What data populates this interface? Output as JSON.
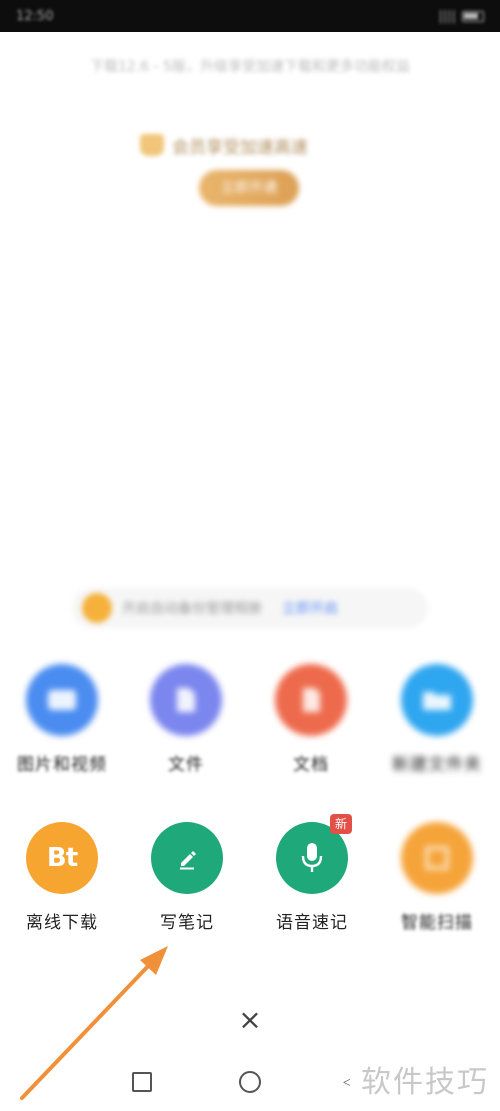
{
  "status_bar": {
    "time": "12:50",
    "signal": "||||"
  },
  "background": {
    "notice": "下载12.6 - 5版，升级享受加速下载和更多功能权益",
    "promo_title": "会员享受加速高速",
    "promo_button": "立即开通",
    "tip_text": "开启自动备份管理相册",
    "tip_link": "立即开启"
  },
  "grid_top": [
    {
      "label": "图片和视频",
      "icon": "image-icon",
      "color": "#4a8cf0"
    },
    {
      "label": "文件",
      "icon": "file-icon",
      "color": "#7b86ee"
    },
    {
      "label": "文档",
      "icon": "document-icon",
      "color": "#ee6a4c"
    },
    {
      "label": "新建文件夹",
      "icon": "folder-icon",
      "color": "#2fa6f0"
    }
  ],
  "grid_bottom": [
    {
      "label": "离线下载",
      "icon": "bt-icon",
      "icon_text": "Bt",
      "color": "#f6a531"
    },
    {
      "label": "写笔记",
      "icon": "pencil-icon",
      "color": "#1fa87a"
    },
    {
      "label": "语音速记",
      "icon": "microphone-icon",
      "color": "#1fa87a",
      "badge": "新"
    },
    {
      "label": "智能扫描",
      "icon": "scan-icon",
      "color": "#f5a43a"
    }
  ],
  "close_label": "×",
  "nav": {
    "back": "◁"
  },
  "watermark": "软件技巧",
  "accent_arrow_color": "#f0913a"
}
